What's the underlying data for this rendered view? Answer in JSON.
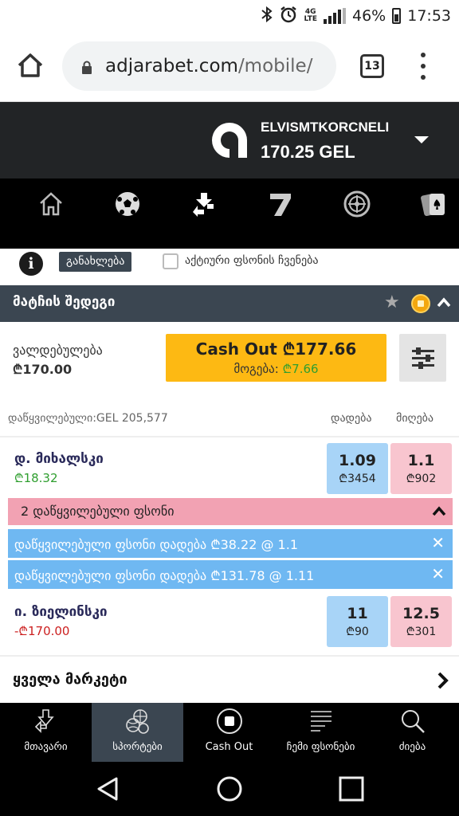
{
  "status_bar": {
    "battery": "46%",
    "time": "17:53",
    "network": "4G LTE",
    "icons": [
      "bluetooth-icon",
      "alarm-icon",
      "lte-icon",
      "signal-icon",
      "battery-icon"
    ]
  },
  "browser": {
    "url_domain": "adjarabet.com",
    "url_path": "/mobile/",
    "tab_count": "13"
  },
  "account": {
    "username": "ELVISMTKORCNELI",
    "balance": "170.25 GEL"
  },
  "category_nav": [
    "home-icon",
    "football-icon",
    "exchange-icon",
    "slots-seven-icon",
    "roulette-icon",
    "cards-icon"
  ],
  "info_row": {
    "update_label": "განახლება",
    "live_label": "აქტიური ფსონის ჩვენება"
  },
  "section": {
    "title": "მატჩის შედეგი"
  },
  "cashout": {
    "stake_label": "ვალდებულება",
    "stake_value": "₾170.00",
    "button_label": "Cash Out ₾177.66",
    "profit_label": "მოგება:",
    "profit_value": "₾7.66"
  },
  "market": {
    "matched_label": "დაწყვილებული:GEL 205,577",
    "back_header": "დადება",
    "lay_header": "მიღება"
  },
  "runners": [
    {
      "name": "დ. მიხალსკი",
      "pl": "₾18.32",
      "back_price": "1.09",
      "back_size": "₾3454",
      "lay_price": "1.1",
      "lay_size": "₾902"
    },
    {
      "name": "ი. ზიელინსკი",
      "pl": "-₾170.00",
      "back_price": "11",
      "back_size": "₾90",
      "lay_price": "12.5",
      "lay_size": "₾301"
    }
  ],
  "matched_bets": {
    "header": "2 დაწყვილებული ფსონი",
    "rows": [
      "დაწყვილებული ფსონი დადება ₾38.22 @ 1.1",
      "დაწყვილებული ფსონი დადება ₾131.78 @ 1.11"
    ]
  },
  "all_markets": "ყველა მარკეტი",
  "bottom_nav": [
    {
      "label": "მთავარი",
      "icon": "main-arrows-icon"
    },
    {
      "label": "სპორტები",
      "icon": "sports-balls-icon"
    },
    {
      "label": "Cash Out",
      "icon": "cashout-icon"
    },
    {
      "label": "ჩემი ფსონები",
      "icon": "my-bets-icon"
    },
    {
      "label": "ძიება",
      "icon": "search-icon"
    }
  ],
  "colors": {
    "header_dark": "#222426",
    "section_slate": "#3b4651",
    "cashout_yellow": "#fdb913",
    "back_blue": "#a8d4f7",
    "lay_pink": "#f8c5cf",
    "matched_pink": "#f2a2b3",
    "matched_row_blue": "#6fb8f2",
    "profit_green": "#2f9e2f",
    "loss_red": "#cc1f1f"
  }
}
